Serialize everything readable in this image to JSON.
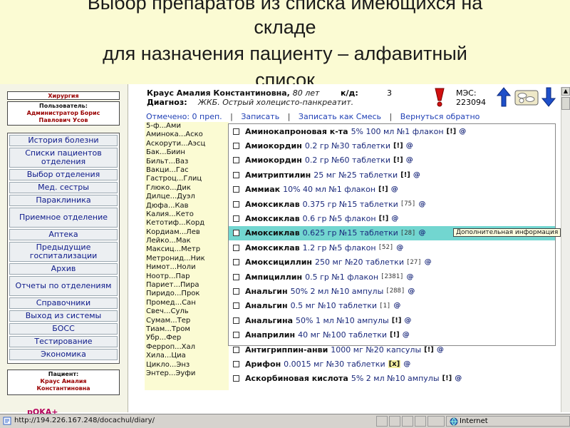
{
  "slide": {
    "title_lines": [
      "Выбор препаратов из списка имеющихся на",
      "складе",
      "для назначения пациенту – алфавитный",
      "список"
    ]
  },
  "sidebar": {
    "department": "Хирургия",
    "user_label": "Пользователь:",
    "user_name_line1": "Администратор Борис",
    "user_name_line2": "Павлович Усов",
    "nav": [
      "История болезни",
      "Списки пациентов отделения",
      "Выбор отделения",
      "Мед. сестры",
      "Параклиника",
      "Приемное отделение",
      "Аптека",
      "Предыдущие госпитализации",
      "Архив",
      "Отчеты по отделениям",
      "Справочники",
      "Выход из системы",
      "БОСС",
      "Тестирование",
      "Экономика"
    ],
    "patient_label": "Пациент:",
    "patient_line1": "Краус Амалия",
    "patient_line2": "Константиновна",
    "logo": "pOKA+"
  },
  "patient": {
    "name": "Краус Амалия Константиновна,",
    "age": "80 лет",
    "kd_label": "к/д:",
    "kd_value": "3",
    "diagnosis_label": "Диагноз:",
    "diagnosis_value": "ЖКБ. Острый холецисто-панкреатит.",
    "mes_label": "МЭС:",
    "mes_value": "223094"
  },
  "actions": {
    "marked": "Отмечено: 0 преп.",
    "save": "Записать",
    "save_as_mix": "Записать как Смесь",
    "go_back": "Вернуться обратно"
  },
  "alphabet_index": [
    "5-ф...Ами",
    "Аминока...Аско",
    "Аскорути...Аэсц",
    "Бак...Биин",
    "Бильт...Ваз",
    "Вакци...Гас",
    "Гастроц...Глиц",
    "Глюко...Дик",
    "Дилце...Дуэл",
    "Дюфа...Кав",
    "Калия...Кето",
    "Кетотиф...Корд",
    "Кордиам...Лев",
    "Лейко...Мак",
    "Максиц...Метр",
    "Метронид...Ник",
    "Нимот...Ноли",
    "Ноотр...Пар",
    "Париет...Пира",
    "Пиридо...Прок",
    "Промед...Сан",
    "Свеч...Суль",
    "Сумам...Тер",
    "Тиам...Тром",
    "Убр...Фер",
    "Ферроп...Хал",
    "Хила...Циа",
    "Цикло...Энз",
    "Энтер...Эуфи"
  ],
  "drugs": [
    {
      "name": "Аминокапроновая к-та",
      "dose": "5% 100 мл №1 флакон",
      "stock": "",
      "flag": "[!]",
      "info": "@"
    },
    {
      "name": "Амиокордин",
      "dose": "0.2 гр №30 таблетки",
      "stock": "",
      "flag": "[!]",
      "info": "@"
    },
    {
      "name": "Амиокордин",
      "dose": "0.2 гр №60 таблетки",
      "stock": "",
      "flag": "[!]",
      "info": "@"
    },
    {
      "name": "Амитриптилин",
      "dose": "25 мг №25 таблетки",
      "stock": "",
      "flag": "[!]",
      "info": "@"
    },
    {
      "name": "Аммиак",
      "dose": "10% 40 мл №1 флакон",
      "stock": "",
      "flag": "[!]",
      "info": "@"
    },
    {
      "name": "Амоксиклав",
      "dose": "0.375 гр №15 таблетки",
      "stock": "[75]",
      "flag": "",
      "info": "@"
    },
    {
      "name": "Амоксиклав",
      "dose": "0.6 гр №5 флакон",
      "stock": "",
      "flag": "[!]",
      "info": "@"
    },
    {
      "name": "Амоксиклав",
      "dose": "0.625 гр №15 таблетки",
      "stock": "[28]",
      "flag": "",
      "info": "@"
    },
    {
      "name": "Амоксиклав",
      "dose": "1.2 гр №5 флакон",
      "stock": "[52]",
      "flag": "",
      "info": "@"
    },
    {
      "name": "Амоксициллин",
      "dose": "250 мг №20 таблетки",
      "stock": "[27]",
      "flag": "",
      "info": "@"
    },
    {
      "name": "Ампициллин",
      "dose": "0.5 гр №1 флакон",
      "stock": "[2381]",
      "flag": "",
      "info": "@"
    },
    {
      "name": "Анальгин",
      "dose": "50% 2 мл №10 ампулы",
      "stock": "[288]",
      "flag": "",
      "info": "@"
    },
    {
      "name": "Анальгин",
      "dose": "0.5 мг №10 таблетки",
      "stock": "[1]",
      "flag": "",
      "info": "@"
    },
    {
      "name": "Анальгина",
      "dose": "50% 1 мл №10 ампулы",
      "stock": "",
      "flag": "[!]",
      "info": "@"
    },
    {
      "name": "Анаприлин",
      "dose": "40 мг №100 таблетки",
      "stock": "",
      "flag": "[!]",
      "info": "@"
    },
    {
      "name": "Антигриппин-анви",
      "dose": "1000 мг №20 капсулы",
      "stock": "",
      "flag": "[!]",
      "info": "@"
    },
    {
      "name": "Арифон",
      "dose": "0.0015 мг №30 таблетки",
      "stock": "",
      "flag": "[x]",
      "info": "@"
    },
    {
      "name": "Аскорбиновая кислота",
      "dose": "5% 2 мл №10 ампулы",
      "stock": "",
      "flag": "[!]",
      "info": "@"
    }
  ],
  "selected_drug_index": 7,
  "tooltip": "Дополнительная информация",
  "statusbar": {
    "url": "http://194.226.167.248/docachul/diary/",
    "zone": "Internet"
  },
  "colors": {
    "slide_bg": "#fbfbd3",
    "selected_row": "#72d6d0",
    "link": "#1f3fb5",
    "nav_text": "#0d1a8a",
    "sidebar_red": "#990000"
  }
}
